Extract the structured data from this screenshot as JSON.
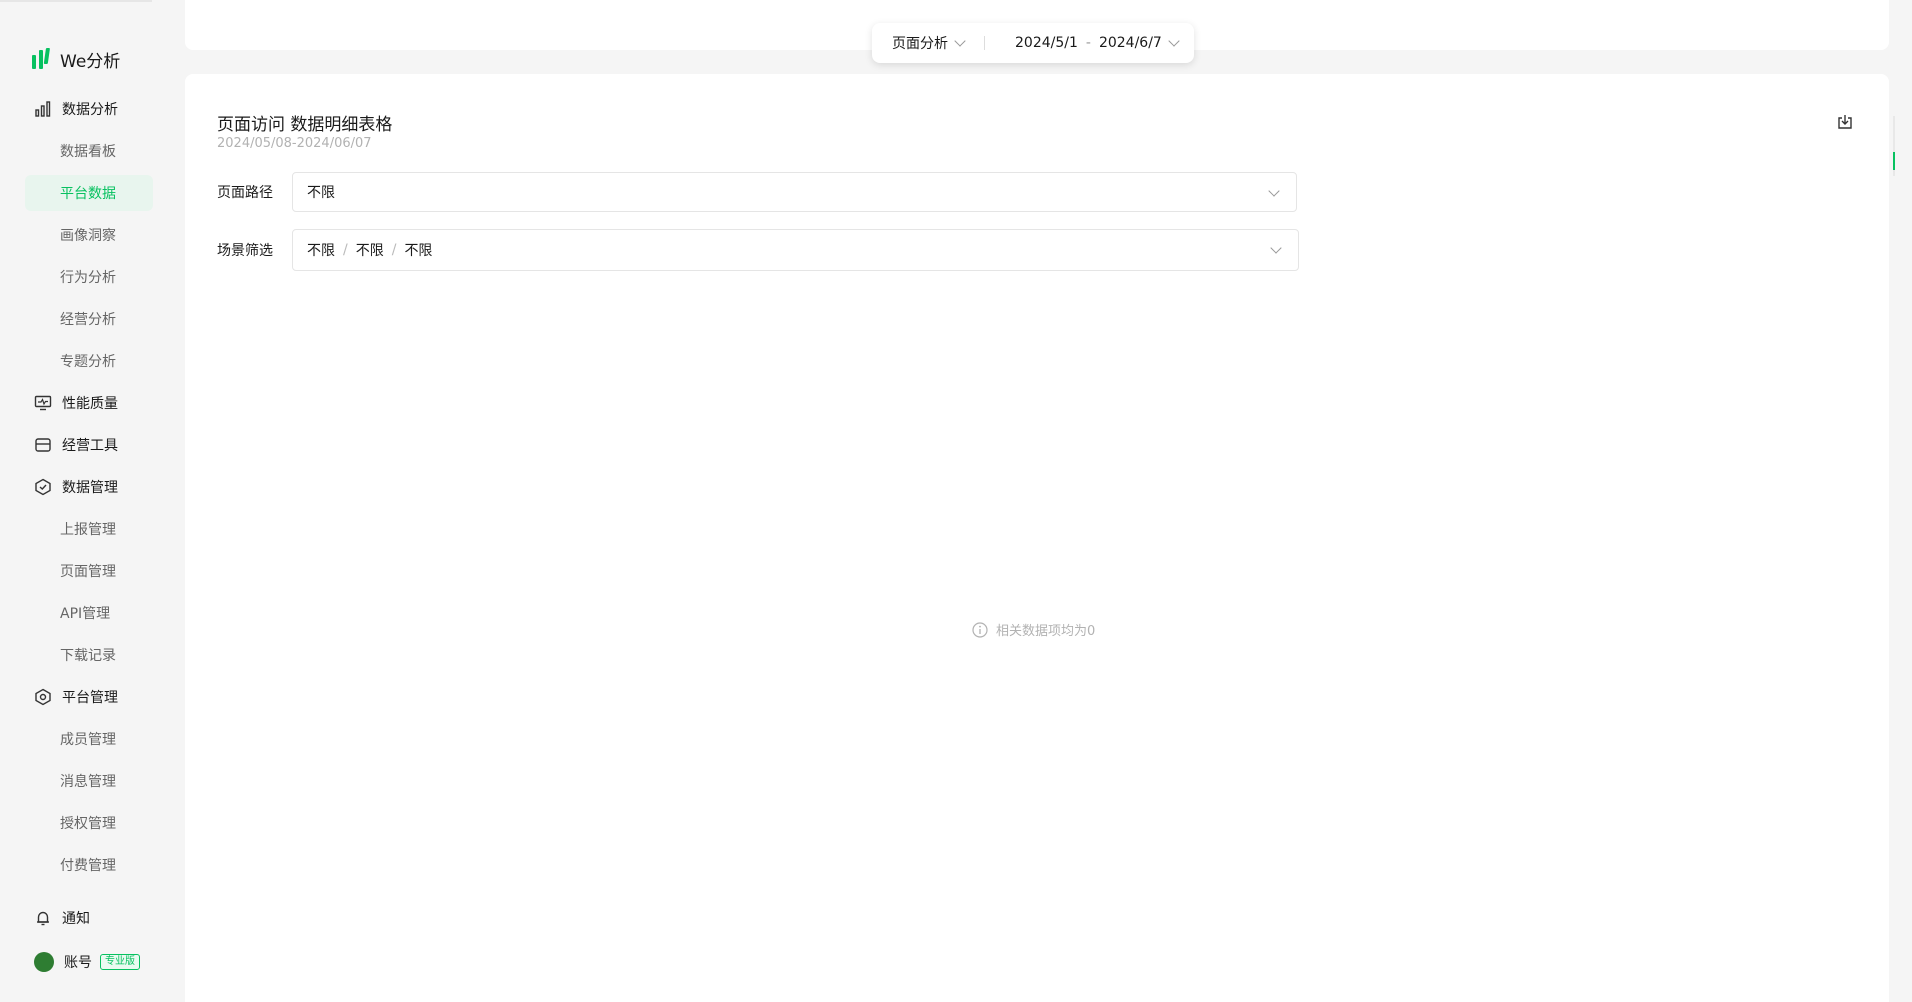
{
  "app": {
    "logo_text": "We分析",
    "brand_color": "#07c160"
  },
  "sidebar": {
    "groups": [
      {
        "label": "数据分析",
        "icon": "bar-chart-icon",
        "items": [
          "数据看板",
          "平台数据",
          "画像洞察",
          "行为分析",
          "经营分析",
          "专题分析"
        ]
      },
      {
        "label": "性能质量",
        "icon": "monitor-icon",
        "items": []
      },
      {
        "label": "经营工具",
        "icon": "store-icon",
        "items": []
      },
      {
        "label": "数据管理",
        "icon": "cube-check-icon",
        "items": [
          "上报管理",
          "页面管理",
          "API管理",
          "下载记录"
        ]
      },
      {
        "label": "平台管理",
        "icon": "hexagon-settings-icon",
        "items": [
          "成员管理",
          "消息管理",
          "授权管理",
          "付费管理"
        ]
      }
    ],
    "active_item": "平台数据",
    "notification_label": "通知",
    "account_label": "账号",
    "account_badge": "专业版"
  },
  "top_filter": {
    "page_type": "页面分析",
    "date_start": "2024/5/1",
    "date_sep": "-",
    "date_end": "2024/6/7"
  },
  "main": {
    "title": "页面访问 数据明细表格",
    "date_range": "2024/05/08-2024/06/07",
    "path_label": "页面路径",
    "path_value": "不限",
    "scene_label": "场景筛选",
    "scene_values": [
      "不限",
      "不限",
      "不限"
    ],
    "scene_sep": "/",
    "empty_text": "相关数据项均为0"
  }
}
